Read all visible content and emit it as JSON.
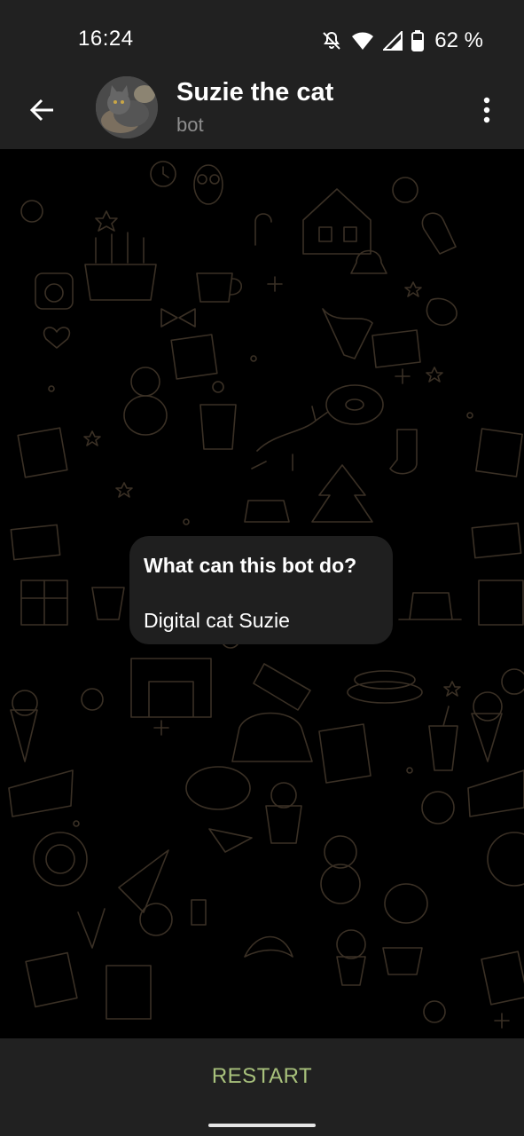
{
  "status_bar": {
    "time": "16:24",
    "battery_percent": "62 %",
    "icons": [
      "bell-off-icon",
      "wifi-icon",
      "signal-icon",
      "battery-icon"
    ]
  },
  "header": {
    "title": "Suzie the cat",
    "subtitle": "bot",
    "back_icon": "arrow-left-icon",
    "menu_icon": "more-vertical-icon",
    "avatar": "cat-photo"
  },
  "bot_info": {
    "title": "What can this bot do?",
    "description": "Digital cat Suzie"
  },
  "bottom": {
    "restart_label": "RESTART"
  },
  "colors": {
    "bar_background": "#212121",
    "chat_background": "#000000",
    "bubble_background": "#1f1f1f",
    "accent": "#a8c17c",
    "subtitle": "#8e8e8e"
  }
}
